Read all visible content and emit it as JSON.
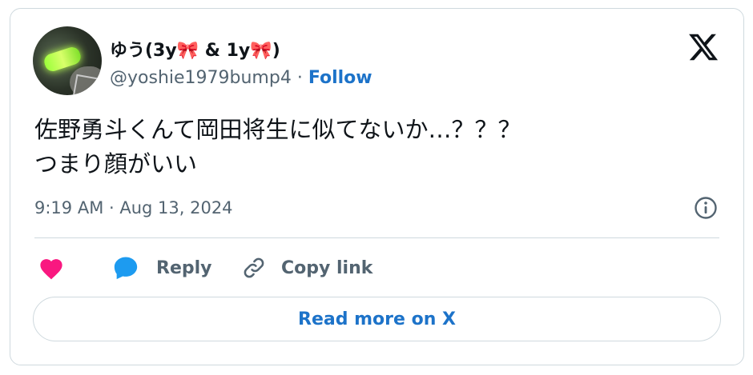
{
  "author": {
    "name_prefix": "ゆう(3y",
    "bow1": "🎀",
    "name_middle": " & 1y",
    "bow2": "🎀",
    "name_suffix": ")",
    "handle": "@yoshie1979bump4",
    "separator": " · ",
    "follow_label": "Follow"
  },
  "tweet": {
    "line1": "佐野勇斗くんて岡田将生に似てないか…？？？",
    "line2": "つまり顔がいい",
    "timestamp": "9:19 AM · Aug 13, 2024"
  },
  "actions": {
    "reply_label": "Reply",
    "copy_link_label": "Copy link"
  },
  "footer": {
    "read_more_label": "Read more on X"
  },
  "colors": {
    "heart": "#f91880",
    "reply_bubble": "#1d9bf0",
    "link": "#1d73c9",
    "border": "#cfd9de",
    "muted": "#536471",
    "text": "#0f1419"
  },
  "icons": [
    "x-logo-icon",
    "info-icon",
    "heart-icon",
    "reply-bubble-icon",
    "link-icon"
  ]
}
